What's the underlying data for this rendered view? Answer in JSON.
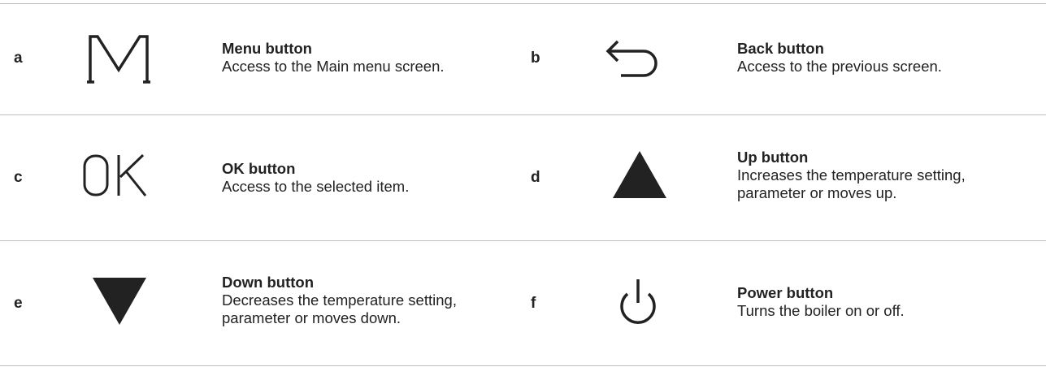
{
  "items": [
    {
      "letter": "a",
      "icon": "menu-m-icon",
      "title": "Menu button",
      "description": "Access to the Main menu screen."
    },
    {
      "letter": "b",
      "icon": "back-arrow-icon",
      "title": "Back button",
      "description": "Access to the previous screen."
    },
    {
      "letter": "c",
      "icon": "ok-icon",
      "icon_text": "OK",
      "title": "OK button",
      "description": "Access to the selected item."
    },
    {
      "letter": "d",
      "icon": "up-triangle-icon",
      "title": "Up button",
      "description": "Increases the temperature setting,\nparameter or moves up."
    },
    {
      "letter": "e",
      "icon": "down-triangle-icon",
      "title": "Down button",
      "description": "Decreases the temperature setting,\nparameter or moves down."
    },
    {
      "letter": "f",
      "icon": "power-icon",
      "title": "Power button",
      "description": "Turns the boiler on or off."
    }
  ],
  "colors": {
    "text": "#222222",
    "icon": "#222222",
    "rule": "#bdbdbd"
  }
}
